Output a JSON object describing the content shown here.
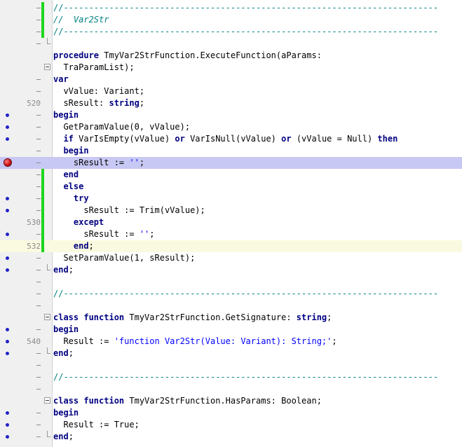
{
  "editor": {
    "lines": [
      {
        "parts": [
          {
            "t": "//--------------------------------------------------------------------------",
            "c": "cmd"
          }
        ],
        "num": "",
        "mod": true,
        "fold": "",
        "gutter": "tick",
        "hl": ""
      },
      {
        "parts": [
          {
            "t": "//  Var2Str",
            "c": "cm"
          }
        ],
        "num": "",
        "mod": true,
        "fold": "",
        "gutter": "tick",
        "hl": ""
      },
      {
        "parts": [
          {
            "t": "//--------------------------------------------------------------------------",
            "c": "cmd"
          }
        ],
        "num": "",
        "mod": true,
        "fold": "",
        "gutter": "tick",
        "hl": ""
      },
      {
        "parts": [],
        "num": "",
        "mod": false,
        "fold": "end",
        "gutter": "tick",
        "hl": ""
      },
      {
        "parts": [
          {
            "t": "procedure",
            "c": "kw"
          },
          {
            "t": " TmyVar2StrFunction.ExecuteFunction(aParams:",
            "c": ""
          }
        ],
        "num": "",
        "mod": false,
        "fold": "",
        "gutter": "",
        "hl": ""
      },
      {
        "parts": [
          {
            "t": "  TraParamList);",
            "c": ""
          }
        ],
        "num": "",
        "mod": false,
        "fold": "box",
        "gutter": "",
        "hl": ""
      },
      {
        "parts": [
          {
            "t": "var",
            "c": "kw"
          }
        ],
        "num": "",
        "mod": false,
        "fold": "",
        "gutter": "tick",
        "hl": ""
      },
      {
        "parts": [
          {
            "t": "  vValue: Variant;",
            "c": ""
          }
        ],
        "num": "",
        "mod": false,
        "fold": "",
        "gutter": "tick",
        "hl": ""
      },
      {
        "parts": [
          {
            "t": "  sResult: ",
            "c": ""
          },
          {
            "t": "string",
            "c": "kw"
          },
          {
            "t": ";",
            "c": ""
          }
        ],
        "num": "520",
        "mod": false,
        "fold": "",
        "gutter": "",
        "hl": ""
      },
      {
        "parts": [
          {
            "t": "begin",
            "c": "kw"
          }
        ],
        "num": "",
        "mod": false,
        "fold": "",
        "gutter": "dot",
        "hl": ""
      },
      {
        "parts": [
          {
            "t": "  GetParamValue(0, vValue);",
            "c": ""
          }
        ],
        "num": "",
        "mod": false,
        "fold": "",
        "gutter": "dot",
        "hl": ""
      },
      {
        "parts": [
          {
            "t": "  ",
            "c": ""
          },
          {
            "t": "if",
            "c": "kw"
          },
          {
            "t": " VarIsEmpty(vValue) ",
            "c": ""
          },
          {
            "t": "or",
            "c": "kw"
          },
          {
            "t": " VarIsNull(vValue) ",
            "c": ""
          },
          {
            "t": "or",
            "c": "kw"
          },
          {
            "t": " (vValue = Null) ",
            "c": ""
          },
          {
            "t": "then",
            "c": "kw"
          }
        ],
        "num": "",
        "mod": false,
        "fold": "",
        "gutter": "dot",
        "hl": ""
      },
      {
        "parts": [
          {
            "t": "  ",
            "c": ""
          },
          {
            "t": "begin",
            "c": "kw"
          }
        ],
        "num": "",
        "mod": false,
        "fold": "",
        "gutter": "tick",
        "hl": ""
      },
      {
        "parts": [
          {
            "t": "    sResult := ",
            "c": ""
          },
          {
            "t": "''",
            "c": "str"
          },
          {
            "t": ";",
            "c": ""
          }
        ],
        "num": "",
        "mod": false,
        "fold": "",
        "gutter": "bp",
        "hl": "break"
      },
      {
        "parts": [
          {
            "t": "  ",
            "c": ""
          },
          {
            "t": "end",
            "c": "kw"
          }
        ],
        "num": "",
        "mod": true,
        "fold": "",
        "gutter": "tick",
        "hl": ""
      },
      {
        "parts": [
          {
            "t": "  ",
            "c": ""
          },
          {
            "t": "else",
            "c": "kw"
          }
        ],
        "num": "",
        "mod": true,
        "fold": "",
        "gutter": "tick",
        "hl": ""
      },
      {
        "parts": [
          {
            "t": "    ",
            "c": ""
          },
          {
            "t": "try",
            "c": "kw"
          }
        ],
        "num": "",
        "mod": true,
        "fold": "",
        "gutter": "dot",
        "hl": ""
      },
      {
        "parts": [
          {
            "t": "      sResult := Trim(vValue);",
            "c": ""
          }
        ],
        "num": "",
        "mod": true,
        "fold": "",
        "gutter": "dot",
        "hl": ""
      },
      {
        "parts": [
          {
            "t": "    ",
            "c": ""
          },
          {
            "t": "except",
            "c": "kw"
          }
        ],
        "num": "530",
        "mod": true,
        "fold": "",
        "gutter": "",
        "hl": ""
      },
      {
        "parts": [
          {
            "t": "      sResult := ",
            "c": ""
          },
          {
            "t": "''",
            "c": "str"
          },
          {
            "t": ";",
            "c": ""
          }
        ],
        "num": "",
        "mod": true,
        "fold": "",
        "gutter": "dot",
        "hl": ""
      },
      {
        "parts": [
          {
            "t": "    ",
            "c": ""
          },
          {
            "t": "end",
            "c": "kw"
          },
          {
            "t": ";",
            "c": ""
          }
        ],
        "num": "532",
        "mod": true,
        "fold": "",
        "gutter": "",
        "hl": "current"
      },
      {
        "parts": [
          {
            "t": "  SetParamValue(1, sResult);",
            "c": ""
          }
        ],
        "num": "",
        "mod": false,
        "fold": "",
        "gutter": "dot",
        "hl": ""
      },
      {
        "parts": [
          {
            "t": "end",
            "c": "kw"
          },
          {
            "t": ";",
            "c": ""
          }
        ],
        "num": "",
        "mod": false,
        "fold": "end",
        "gutter": "dot",
        "hl": ""
      },
      {
        "parts": [],
        "num": "",
        "mod": false,
        "fold": "",
        "gutter": "tick",
        "hl": ""
      },
      {
        "parts": [
          {
            "t": "//--------------------------------------------------------------------------",
            "c": "cmd"
          }
        ],
        "num": "",
        "mod": false,
        "fold": "",
        "gutter": "tick",
        "hl": ""
      },
      {
        "parts": [],
        "num": "",
        "mod": false,
        "fold": "",
        "gutter": "tick",
        "hl": ""
      },
      {
        "parts": [
          {
            "t": "class",
            "c": "kw"
          },
          {
            "t": " ",
            "c": ""
          },
          {
            "t": "function",
            "c": "kw"
          },
          {
            "t": " TmyVar2StrFunction.GetSignature: ",
            "c": ""
          },
          {
            "t": "string",
            "c": "kw"
          },
          {
            "t": ";",
            "c": ""
          }
        ],
        "num": "",
        "mod": false,
        "fold": "box",
        "gutter": "",
        "hl": ""
      },
      {
        "parts": [
          {
            "t": "begin",
            "c": "kw"
          }
        ],
        "num": "",
        "mod": false,
        "fold": "",
        "gutter": "dot",
        "hl": ""
      },
      {
        "parts": [
          {
            "t": "  Result := ",
            "c": ""
          },
          {
            "t": "'function Var2Str(Value: Variant): String;'",
            "c": "str"
          },
          {
            "t": ";",
            "c": ""
          }
        ],
        "num": "540",
        "mod": false,
        "fold": "",
        "gutter": "dot",
        "hl": ""
      },
      {
        "parts": [
          {
            "t": "end",
            "c": "kw"
          },
          {
            "t": ";",
            "c": ""
          }
        ],
        "num": "",
        "mod": false,
        "fold": "end",
        "gutter": "dot",
        "hl": ""
      },
      {
        "parts": [],
        "num": "",
        "mod": false,
        "fold": "",
        "gutter": "tick",
        "hl": ""
      },
      {
        "parts": [
          {
            "t": "//--------------------------------------------------------------------------",
            "c": "cmd"
          }
        ],
        "num": "",
        "mod": false,
        "fold": "",
        "gutter": "tick",
        "hl": ""
      },
      {
        "parts": [],
        "num": "",
        "mod": false,
        "fold": "",
        "gutter": "tick",
        "hl": ""
      },
      {
        "parts": [
          {
            "t": "class",
            "c": "kw"
          },
          {
            "t": " ",
            "c": ""
          },
          {
            "t": "function",
            "c": "kw"
          },
          {
            "t": " TmyVar2StrFunction.HasParams: Boolean;",
            "c": ""
          }
        ],
        "num": "",
        "mod": false,
        "fold": "box",
        "gutter": "",
        "hl": ""
      },
      {
        "parts": [
          {
            "t": "begin",
            "c": "kw"
          }
        ],
        "num": "",
        "mod": false,
        "fold": "",
        "gutter": "dot",
        "hl": ""
      },
      {
        "parts": [
          {
            "t": "  Result := True;",
            "c": ""
          }
        ],
        "num": "",
        "mod": false,
        "fold": "",
        "gutter": "dot",
        "hl": ""
      },
      {
        "parts": [
          {
            "t": "end",
            "c": "kw"
          },
          {
            "t": ";",
            "c": ""
          }
        ],
        "num": "",
        "mod": false,
        "fold": "end",
        "gutter": "dot",
        "hl": ""
      }
    ]
  },
  "colors": {
    "keyword": "#000080",
    "string": "#0000ff",
    "comment": "#008080",
    "breakpoint_line": "#c8c8f4",
    "current_line": "#fafae0",
    "modified_bar": "#1ed51e",
    "gutter_dot": "#2020c8",
    "breakpoint": "#d01010"
  }
}
